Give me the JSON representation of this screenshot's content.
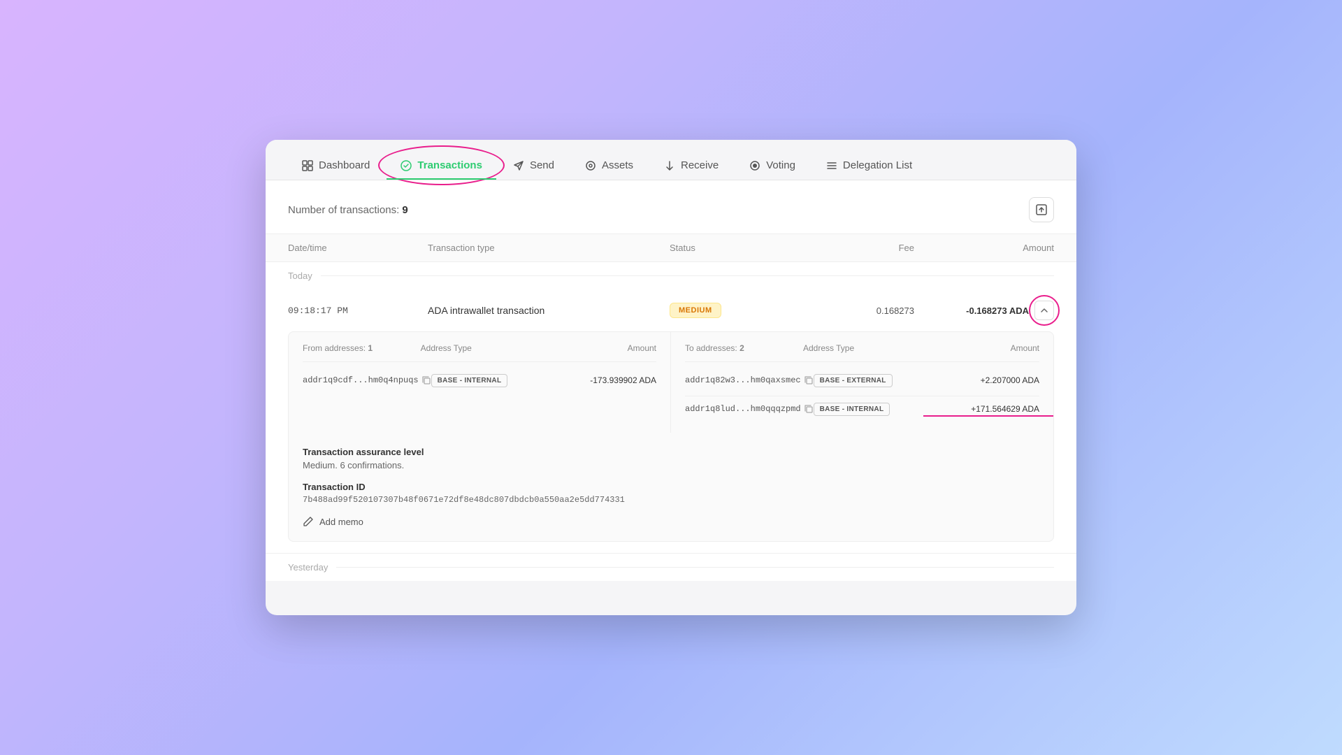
{
  "nav": {
    "items": [
      {
        "id": "dashboard",
        "label": "Dashboard",
        "icon": "⊞",
        "active": false
      },
      {
        "id": "transactions",
        "label": "Transactions",
        "icon": "↻",
        "active": true
      },
      {
        "id": "send",
        "label": "Send",
        "icon": "✈",
        "active": false
      },
      {
        "id": "assets",
        "label": "Assets",
        "icon": "◎",
        "active": false
      },
      {
        "id": "receive",
        "label": "Receive",
        "icon": "↙",
        "active": false
      },
      {
        "id": "voting",
        "label": "Voting",
        "icon": "◉",
        "active": false
      },
      {
        "id": "delegation",
        "label": "Delegation List",
        "icon": "≡",
        "active": false
      }
    ]
  },
  "header": {
    "transactions_label": "Number of transactions:",
    "transactions_count": "9"
  },
  "table": {
    "columns": [
      "Date/time",
      "Transaction type",
      "Status",
      "Fee",
      "Amount"
    ]
  },
  "section_today": "Today",
  "section_yesterday": "Yesterday",
  "transaction": {
    "time": "09:18:17 PM",
    "type": "ADA intrawallet transaction",
    "status": "MEDIUM",
    "fee": "0.168273",
    "amount": "-0.168273 ADA",
    "from_addresses_label": "From addresses:",
    "from_addresses_count": "1",
    "to_addresses_label": "To addresses:",
    "to_addresses_count": "2",
    "address_type_label": "Address Type",
    "amount_label": "Amount",
    "from": [
      {
        "address": "addr1q9cdf...hm0q4npuqs",
        "badge": "BASE - INTERNAL",
        "amount": "-173.939902 ADA"
      }
    ],
    "to": [
      {
        "address": "addr1q82w3...hm0qaxsmec",
        "badge": "BASE - EXTERNAL",
        "amount": "+2.207000 ADA"
      },
      {
        "address": "addr1q8lud...hm0qqqzpmd",
        "badge": "BASE - INTERNAL",
        "amount": "+171.564629 ADA"
      }
    ],
    "assurance_level_label": "Transaction assurance level",
    "assurance_level_value": "Medium. 6 confirmations.",
    "tx_id_label": "Transaction ID",
    "tx_id_value": "7b488ad99f520107307b48f0671e72df8e48dc807dbdcb0a550aa2e5dd774331",
    "add_memo_label": "Add memo"
  }
}
